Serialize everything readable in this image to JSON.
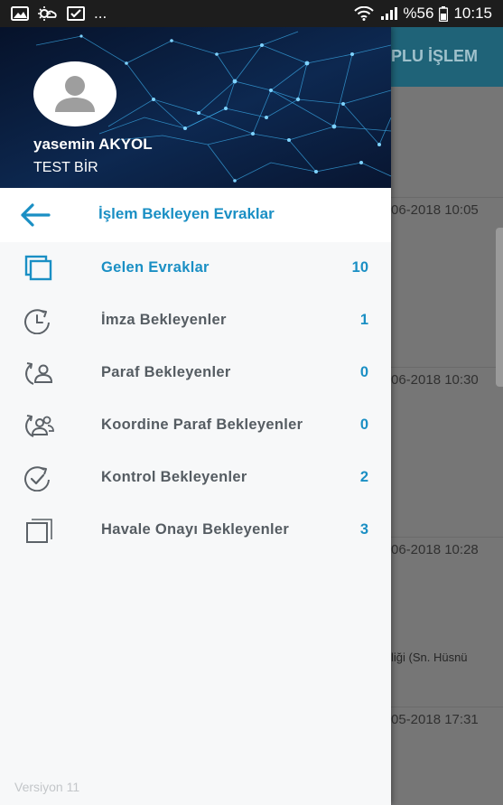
{
  "status_bar": {
    "more": "...",
    "battery": "%56",
    "time": "10:15"
  },
  "background": {
    "toolbar_title": "PLU İŞLEM",
    "timestamps": [
      "06-2018 10:05",
      "06-2018 10:30",
      "06-2018 10:28",
      "05-2018 17:31"
    ],
    "snippet": "liği (Sn. Hüsnü"
  },
  "drawer": {
    "user_name": "yasemin AKYOL",
    "user_org": "TEST BİR",
    "section_title": "İşlem Bekleyen Evraklar",
    "items": [
      {
        "label": "Gelen Evraklar",
        "count": "10",
        "icon": "documents-stack-icon",
        "active": true
      },
      {
        "label": "İmza Bekleyenler",
        "count": "1",
        "icon": "clock-refresh-icon",
        "active": false
      },
      {
        "label": "Paraf Bekleyenler",
        "count": "0",
        "icon": "user-refresh-icon",
        "active": false
      },
      {
        "label": "Koordine Paraf Bekleyenler",
        "count": "0",
        "icon": "users-refresh-icon",
        "active": false
      },
      {
        "label": "Kontrol Bekleyenler",
        "count": "2",
        "icon": "check-refresh-icon",
        "active": false
      },
      {
        "label": "Havale Onayı Bekleyenler",
        "count": "3",
        "icon": "copy-icon",
        "active": false
      }
    ],
    "version": "Versiyon 11"
  },
  "colors": {
    "accent": "#1a8fc4",
    "header_bg": "#0b1830",
    "toolbar_bg": "#1f6378",
    "label_gray": "#555c62"
  }
}
